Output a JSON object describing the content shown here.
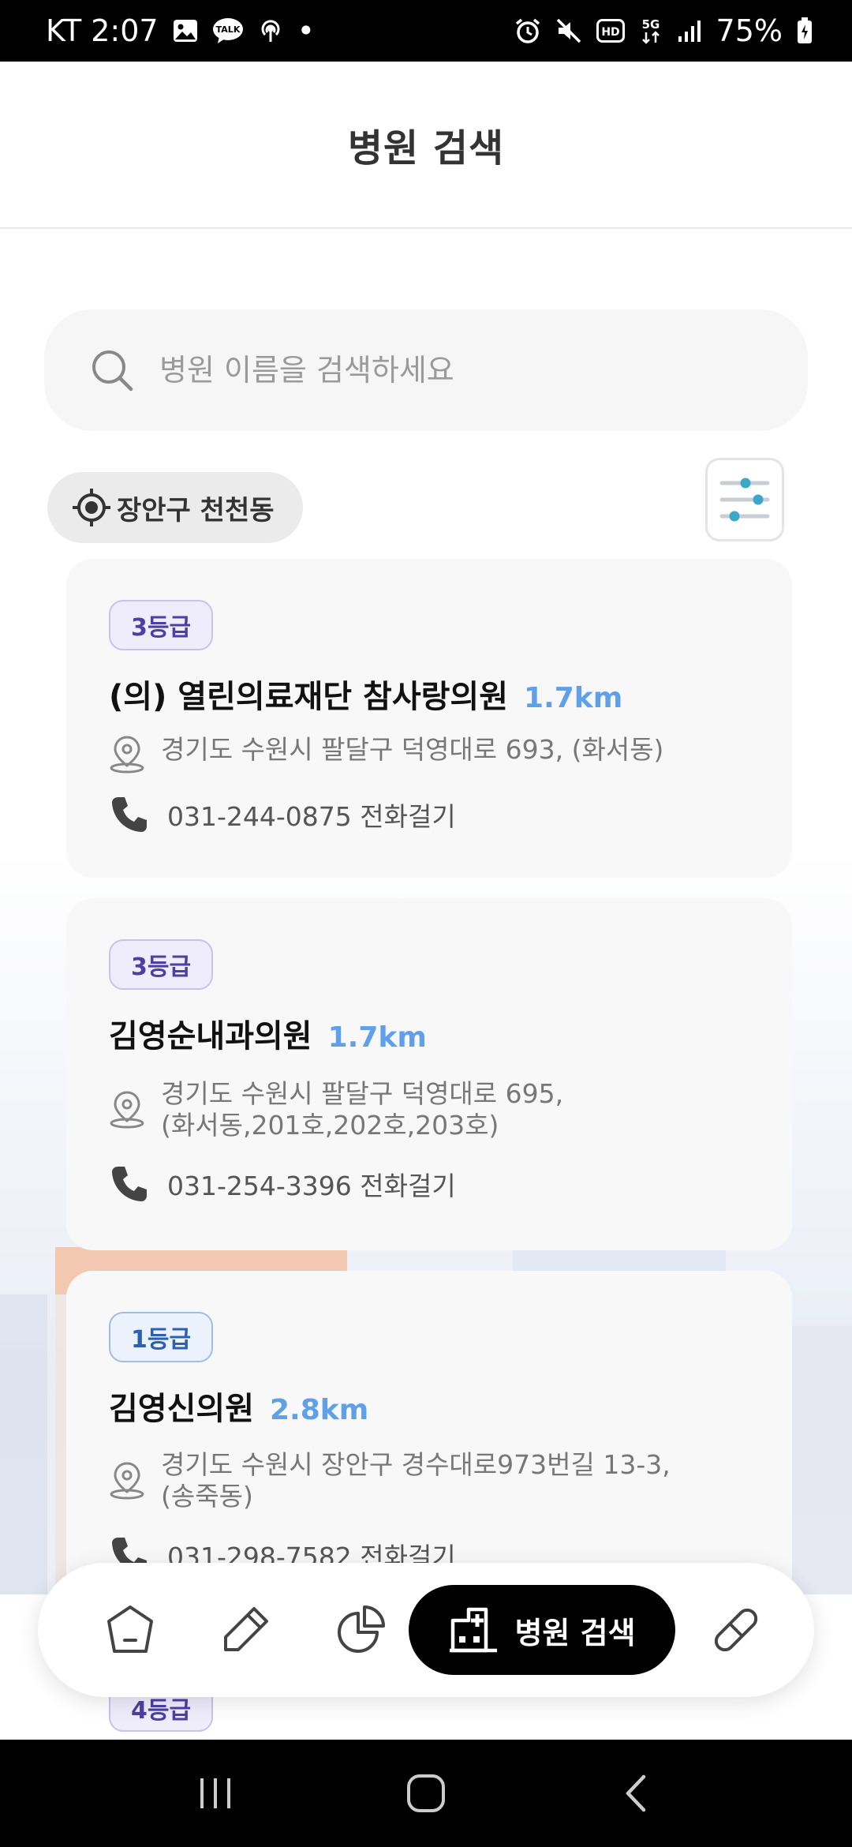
{
  "status_bar": {
    "carrier_time": "KT 2:07",
    "talk_icon_label": "TALK",
    "dot": "•",
    "battery": "75%",
    "icons": [
      "gallery-icon",
      "talk-icon",
      "hotspot-icon",
      "alarm-icon",
      "mute-icon",
      "hd-icon",
      "5g-icon",
      "signal-icon",
      "battery-icon"
    ]
  },
  "header": {
    "title": "병원 검색"
  },
  "search": {
    "placeholder": "병원 이름을 검색하세요"
  },
  "location": {
    "label": "장안구 천천동"
  },
  "hospitals": [
    {
      "grade": "3등급",
      "name": "(의) 열린의료재단 참사랑의원",
      "distance": "1.7km",
      "address": "경기도 수원시 팔달구 덕영대로 693, (화서동)",
      "phone": "031-244-0875 전화걸기"
    },
    {
      "grade": "3등급",
      "name": "김영순내과의원",
      "distance": "1.7km",
      "address": "경기도 수원시 팔달구 덕영대로 695,\n(화서동,201호,202호,203호)",
      "phone": "031-254-3396 전화걸기"
    },
    {
      "grade": "1등급",
      "name": "김영신의원",
      "distance": "2.8km",
      "address": "경기도 수원시 장안구 경수대로973번길 13-3,\n(송죽동)",
      "phone": "031-298-7582 전화걸기"
    },
    {
      "grade": "4등급"
    }
  ],
  "bottom_nav": {
    "active_label": "병원 검색",
    "items": [
      "home-icon",
      "pen-icon",
      "chart-icon",
      "hospital-icon",
      "pill-icon"
    ]
  },
  "colors": {
    "accent_distance": "#5fa0e8",
    "grade_purple": "#4d3fa3",
    "grade_blue": "#2d5fb3",
    "active_nav_bg": "#000000"
  }
}
